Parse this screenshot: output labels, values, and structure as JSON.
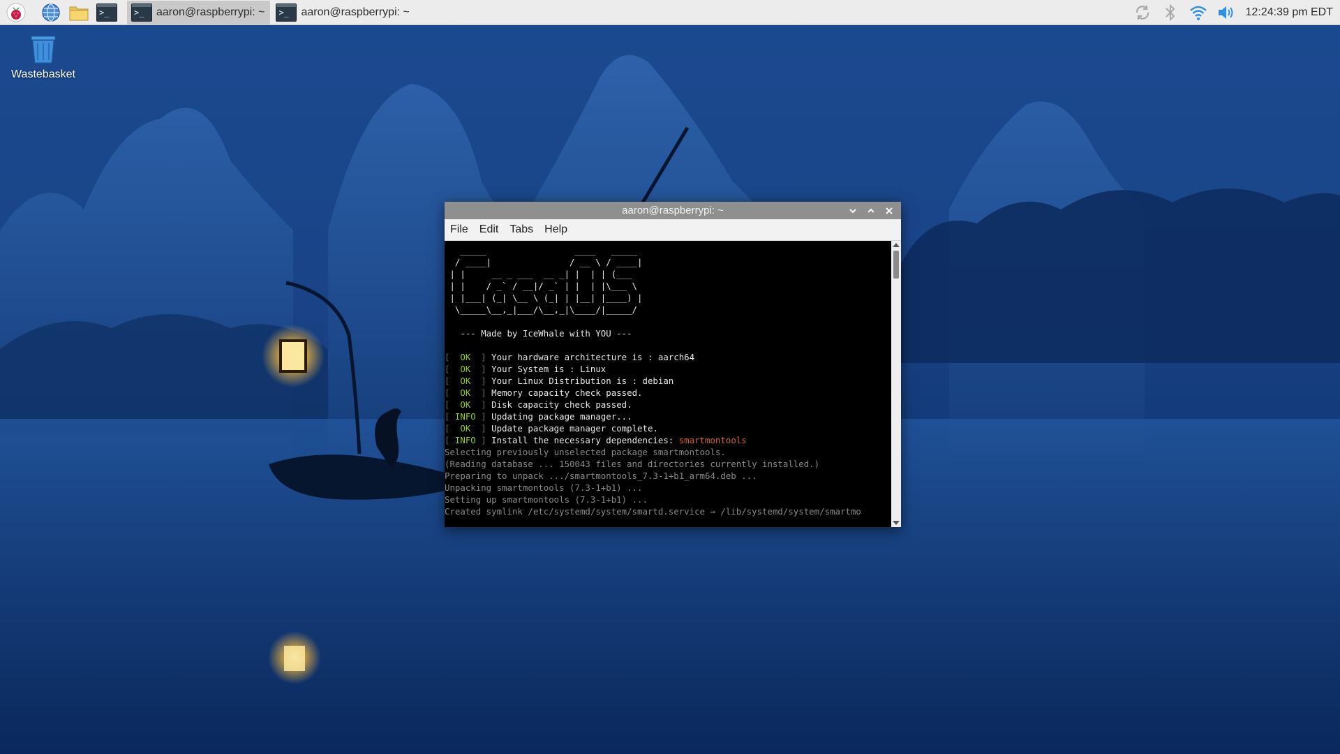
{
  "taskbar": {
    "launchers": [
      {
        "icon": "raspberry-menu-icon"
      },
      {
        "icon": "web-browser-icon"
      },
      {
        "icon": "file-manager-icon"
      },
      {
        "icon": "terminal-icon"
      }
    ],
    "tasks": [
      {
        "label": "aaron@raspberrypi: ~",
        "active": true
      },
      {
        "label": "aaron@raspberrypi: ~",
        "active": false
      }
    ],
    "tray": {
      "icons": [
        "updater-icon",
        "bluetooth-icon",
        "wifi-icon",
        "volume-icon"
      ],
      "clock": "12:24:39 pm EDT"
    }
  },
  "desktop": {
    "icons": [
      {
        "label": "Wastebasket",
        "icon": "wastebasket-icon"
      }
    ]
  },
  "window": {
    "title": "aaron@raspberrypi: ~",
    "menu": [
      "File",
      "Edit",
      "Tabs",
      "Help"
    ],
    "banner": [
      "   _____                 ____   _____ ",
      "  / ____|               / __ \\ / ____|",
      " | |     __ _ ___  __ _| |  | | (___  ",
      " | |    / _` / __|/ _` | |  | |\\___ \\ ",
      " | |___| (_| \\__ \\ (_| | |__| |____) |",
      "  \\_____\\__,_|___/\\__,_|\\____/|_____/ "
    ],
    "made_by": "   --- Made by IceWhale with YOU ---",
    "status_lines": [
      {
        "tag": "OK",
        "text": "Your hardware architecture is : aarch64"
      },
      {
        "tag": "OK",
        "text": "Your System is : Linux"
      },
      {
        "tag": "OK",
        "text": "Your Linux Distribution is : debian"
      },
      {
        "tag": "OK",
        "text": "Memory capacity check passed."
      },
      {
        "tag": "OK",
        "text": "Disk capacity check passed."
      },
      {
        "tag": "INFO",
        "text": "Updating package manager..."
      },
      {
        "tag": "OK",
        "text": "Update package manager complete."
      },
      {
        "tag": "INFO",
        "text": "Install the necessary dependencies: ",
        "highlight": "smartmontools"
      }
    ],
    "log_lines": [
      "Selecting previously unselected package smartmontools.",
      "(Reading database ... 150043 files and directories currently installed.)",
      "Preparing to unpack .../smartmontools_7.3-1+b1_arm64.deb ...",
      "Unpacking smartmontools (7.3-1+b1) ...",
      "Setting up smartmontools (7.3-1+b1) ...",
      "Created symlink /etc/systemd/system/smartd.service → /lib/systemd/system/smartmo"
    ]
  },
  "colors": {
    "ok_green": "#94cf1a",
    "highlight_orange": "#d4652a",
    "taskbar_bg": "#ececec",
    "titlebar_bg": "#8f8f8f"
  }
}
